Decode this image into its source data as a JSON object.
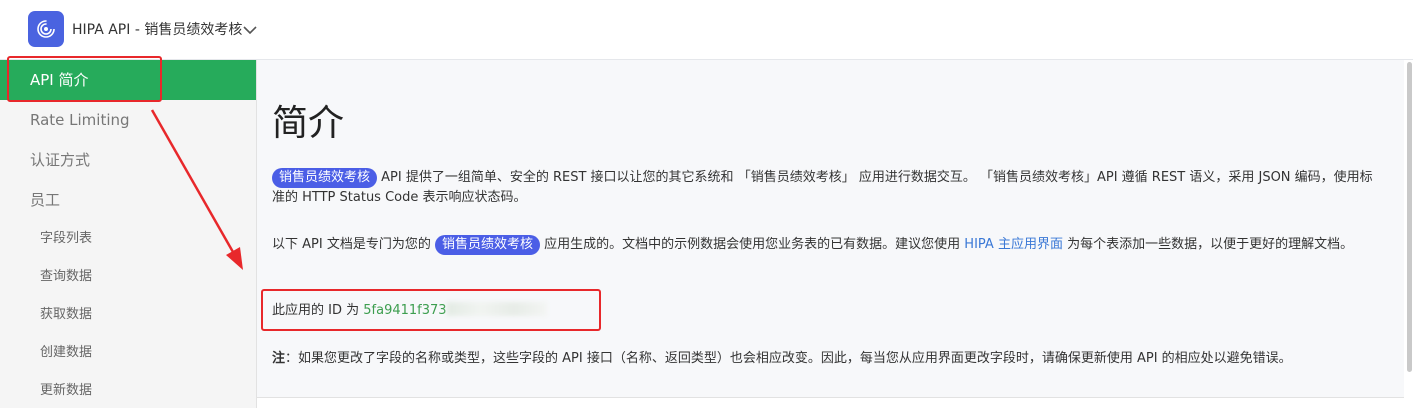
{
  "header": {
    "app_title": "HIPA API - 销售员绩效考核",
    "logo_icon": "swirl-logo-icon",
    "chevron_icon": "chevron-down-icon",
    "accent": "#4a63e0"
  },
  "sidebar": {
    "items": [
      {
        "label": "API 简介",
        "level": "top",
        "active": true
      },
      {
        "label": "Rate Limiting",
        "level": "top",
        "active": false
      },
      {
        "label": "认证方式",
        "level": "top",
        "active": false
      },
      {
        "label": "员工",
        "level": "top",
        "active": false
      },
      {
        "label": "字段列表",
        "level": "sub",
        "active": false
      },
      {
        "label": "查询数据",
        "level": "sub",
        "active": false
      },
      {
        "label": "获取数据",
        "level": "sub",
        "active": false
      },
      {
        "label": "创建数据",
        "level": "sub",
        "active": false
      },
      {
        "label": "更新数据",
        "level": "sub",
        "active": false
      }
    ],
    "active_color": "#26ab5b"
  },
  "main": {
    "title": "简介",
    "p1": {
      "pill": "销售员绩效考核",
      "text": "API 提供了一组简单、安全的 REST 接口以让您的其它系统和 「销售员绩效考核」 应用进行数据交互。 「销售员绩效考核」API 遵循 REST 语义，采用 JSON 编码，使用标准的 HTTP Status Code 表示响应状态码。"
    },
    "p2": {
      "before": "以下 API 文档是专门为您的",
      "pill": "销售员绩效考核",
      "middle": "应用生成的。文档中的示例数据会使用您业务表的已有数据。建议您使用",
      "link": "HIPA 主应用界面",
      "after": "为每个表添加一些数据，以便于更好的理解文档。"
    },
    "p3": {
      "label": "此应用的 ID 为",
      "app_id": "5fa9411f373"
    },
    "note": {
      "label": "注",
      "text": "：如果您更改了字段的名称或类型，这些字段的 API 接口（名称、返回类型）也会相应改变。因此，每当您从应用界面更改字段时，请确保更新使用 API 的相应处以避免错误。"
    },
    "pill_color": "#4b5ee6",
    "link_color": "#3a78d6"
  },
  "annotations": {
    "color": "#e8282b"
  }
}
